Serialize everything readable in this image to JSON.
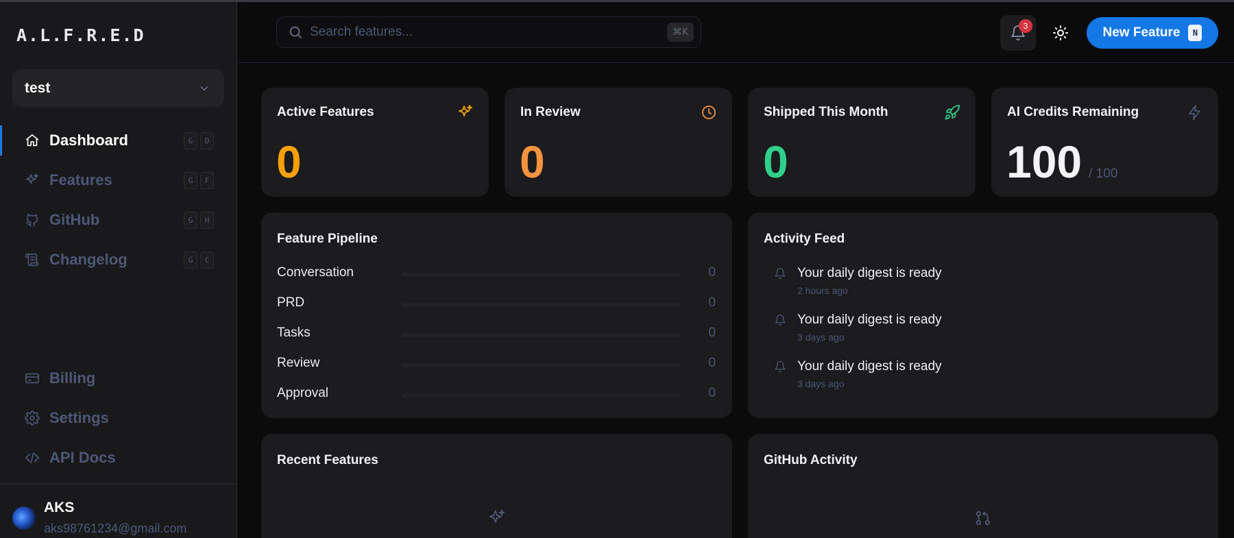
{
  "app": {
    "logo": "A.L.F.R.E.D"
  },
  "workspace": {
    "name": "test"
  },
  "nav": {
    "items": [
      {
        "label": "Dashboard",
        "keys": [
          "G",
          "D"
        ],
        "icon": "home-icon",
        "active": true
      },
      {
        "label": "Features",
        "keys": [
          "G",
          "F"
        ],
        "icon": "sparkle-icon"
      },
      {
        "label": "GitHub",
        "keys": [
          "G",
          "H"
        ],
        "icon": "github-icon"
      },
      {
        "label": "Changelog",
        "keys": [
          "G",
          "C"
        ],
        "icon": "scroll-icon"
      }
    ],
    "bottom_items": [
      {
        "label": "Billing",
        "icon": "card-icon"
      },
      {
        "label": "Settings",
        "icon": "gear-icon"
      },
      {
        "label": "API Docs",
        "icon": "code-icon"
      }
    ]
  },
  "user": {
    "name": "AKS",
    "email": "aks98761234@gmail.com"
  },
  "header": {
    "search_placeholder": "Search features...",
    "search_shortcut": "⌘K",
    "notifications_count": "3",
    "new_feature_label": "New Feature",
    "new_feature_key": "N"
  },
  "stats": [
    {
      "title": "Active Features",
      "value": "0",
      "color": "#f59f0b",
      "icon": "sparkle-icon"
    },
    {
      "title": "In Review",
      "value": "0",
      "color": "#f5923e",
      "icon": "clock-icon"
    },
    {
      "title": "Shipped This Month",
      "value": "0",
      "color": "#2fcf8c",
      "icon": "rocket-icon"
    },
    {
      "title": "AI Credits Remaining",
      "value": "100",
      "suffix": "/ 100",
      "color": "#f2f2f7",
      "icon": "bolt-icon"
    }
  ],
  "pipeline": {
    "title": "Feature Pipeline",
    "stages": [
      {
        "label": "Conversation",
        "count": "0",
        "fill": 0
      },
      {
        "label": "PRD",
        "count": "0",
        "fill": 0
      },
      {
        "label": "Tasks",
        "count": "0",
        "fill": 0
      },
      {
        "label": "Review",
        "count": "0",
        "fill": 0
      },
      {
        "label": "Approval",
        "count": "0",
        "fill": 0
      }
    ]
  },
  "activity": {
    "title": "Activity Feed",
    "items": [
      {
        "text": "Your daily digest is ready",
        "time": "2 hours ago"
      },
      {
        "text": "Your daily digest is ready",
        "time": "3 days ago"
      },
      {
        "text": "Your daily digest is ready",
        "time": "3 days ago"
      }
    ]
  },
  "recent": {
    "title": "Recent Features"
  },
  "github": {
    "title": "GitHub Activity"
  }
}
